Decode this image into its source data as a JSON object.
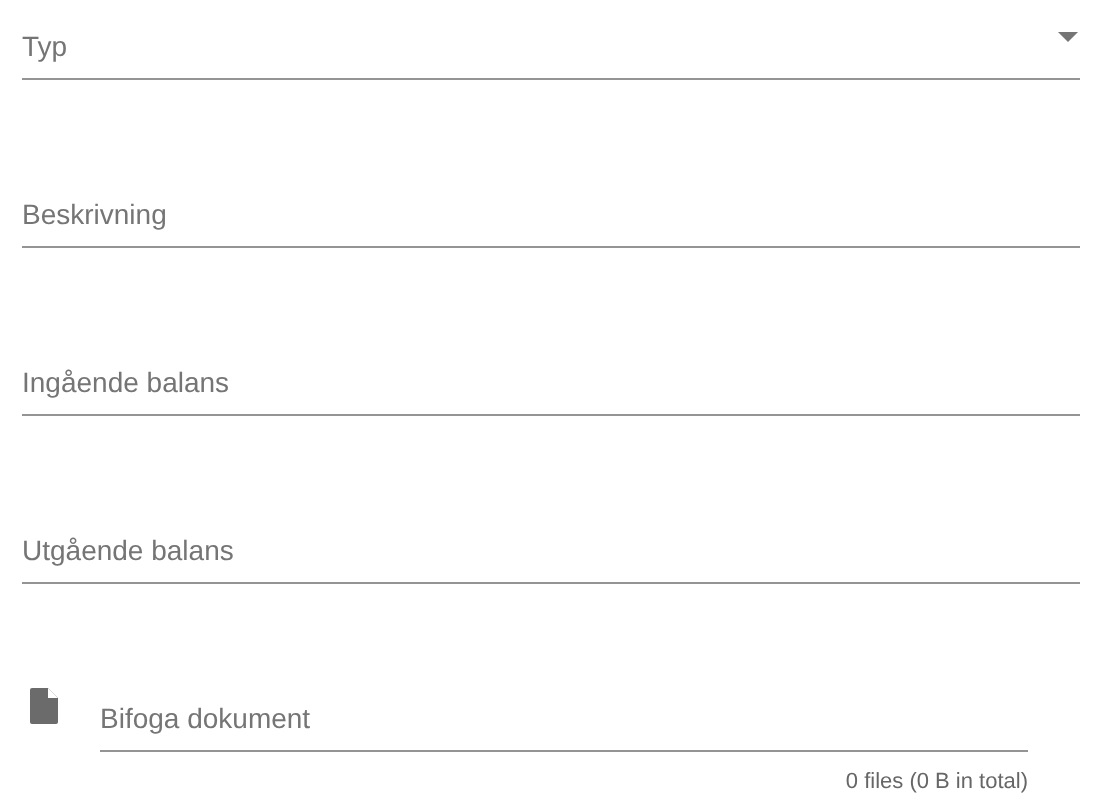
{
  "fields": [
    {
      "kind": "select",
      "placeholder": "Typ"
    },
    {
      "kind": "text",
      "placeholder": "Beskrivning"
    },
    {
      "kind": "text",
      "placeholder": "Ingående balans"
    },
    {
      "kind": "text",
      "placeholder": "Utgående balans"
    }
  ],
  "attachment": {
    "placeholder": "Bifoga dokument",
    "counter": "0 files (0 B in total)"
  }
}
